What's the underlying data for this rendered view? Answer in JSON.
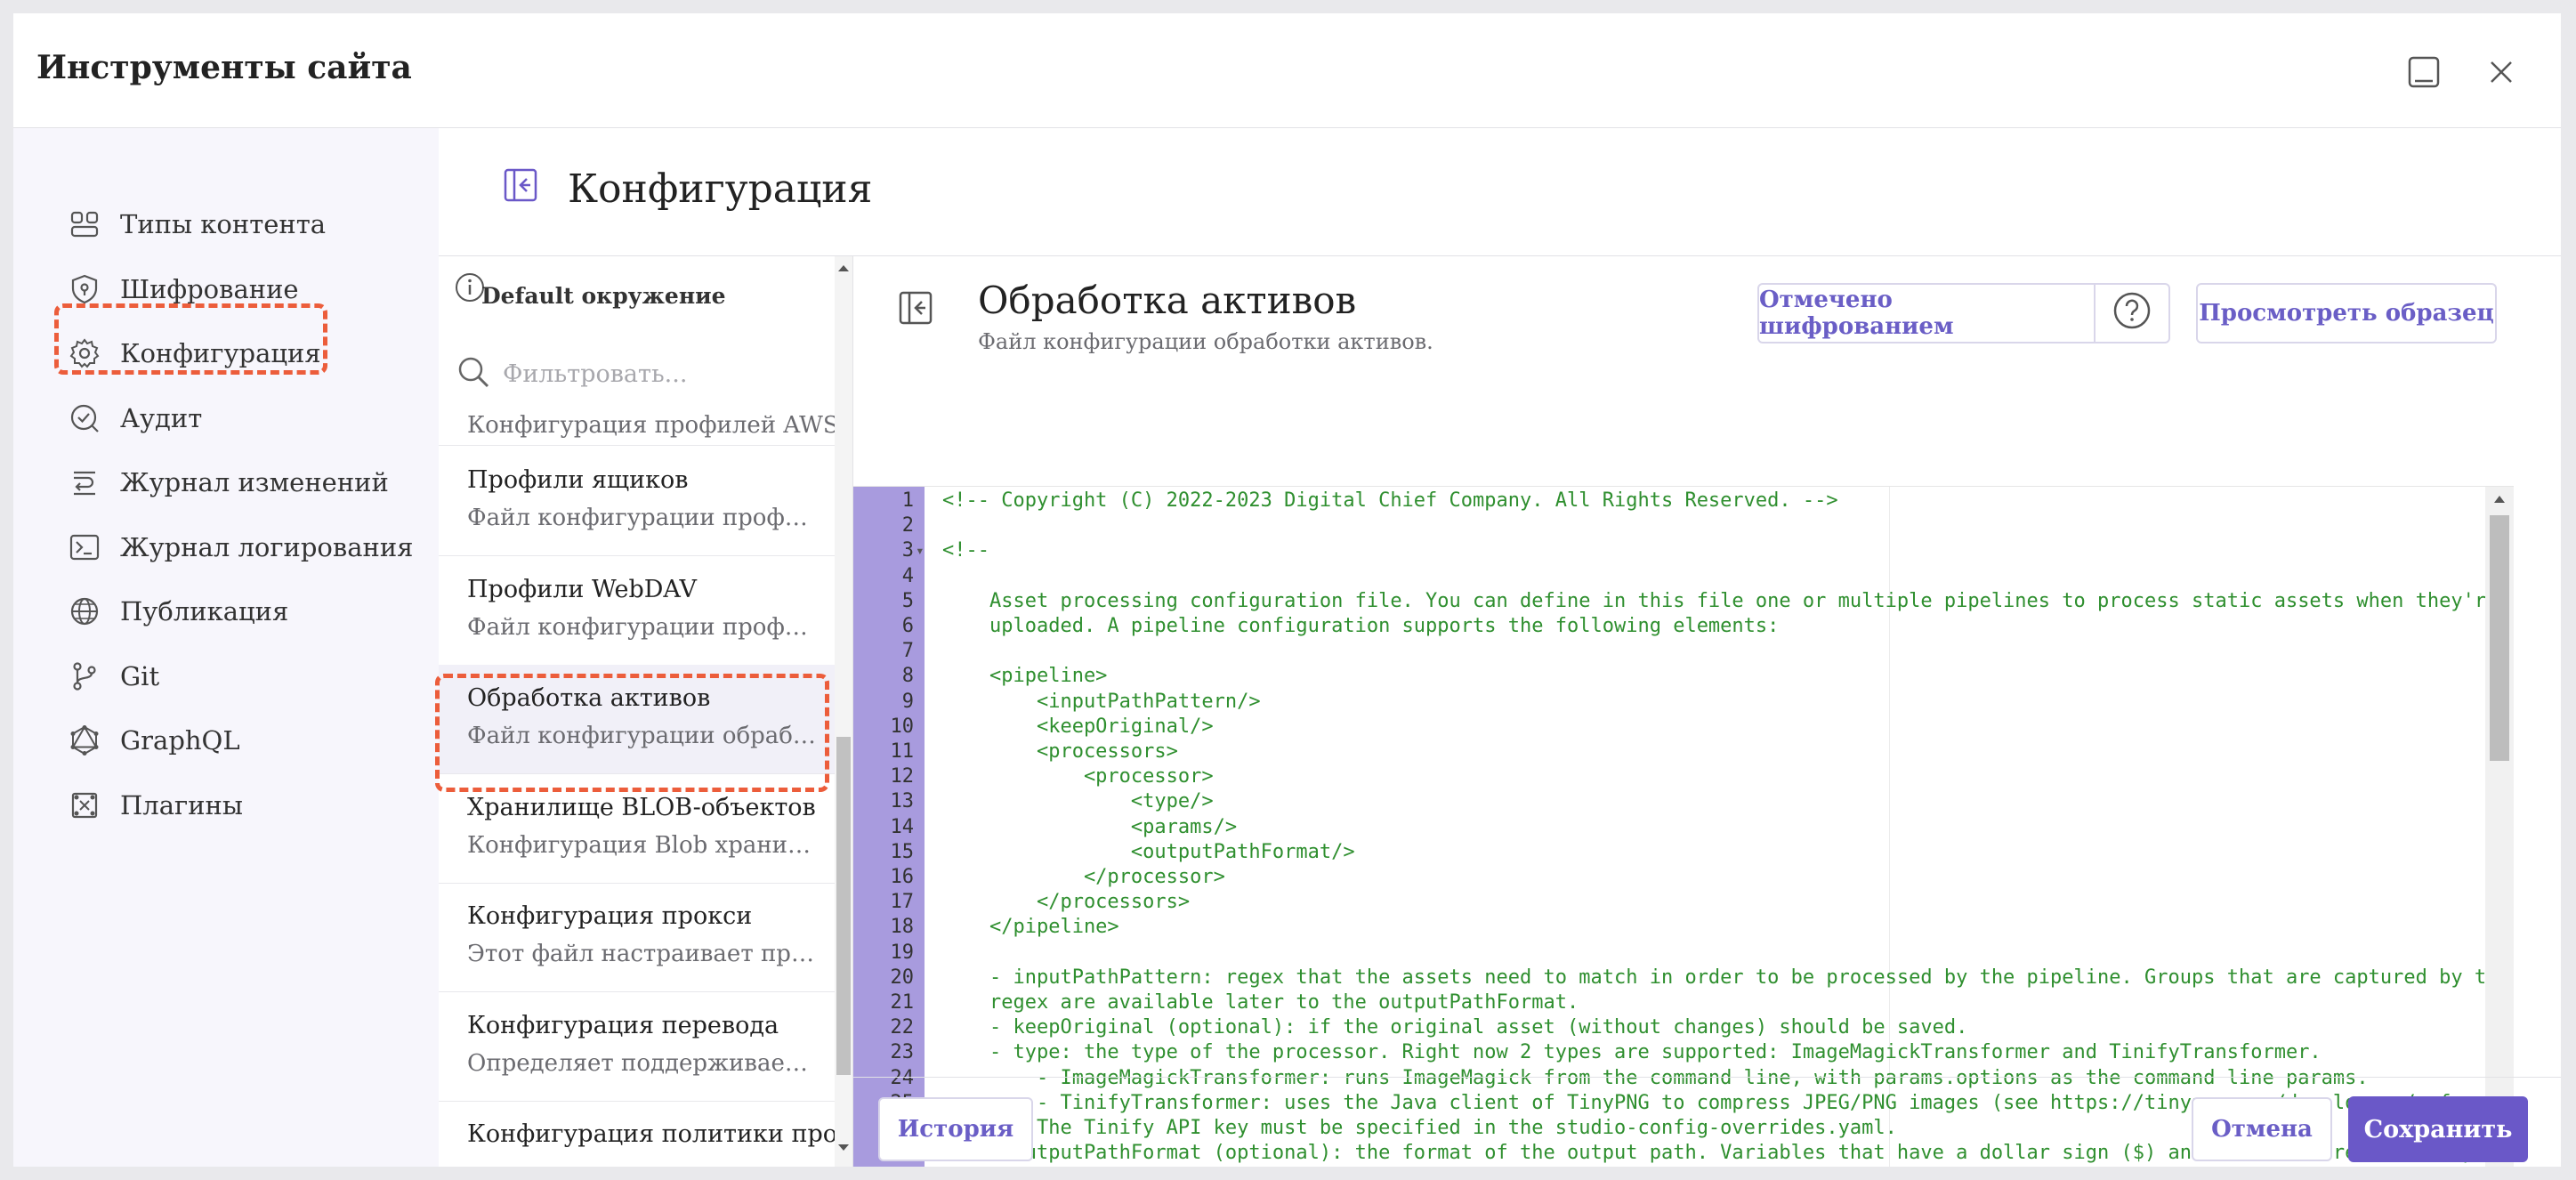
{
  "dialog": {
    "title": "Инструменты сайта"
  },
  "sidebar": {
    "items": [
      {
        "label": "Типы контента",
        "icon": "content-types-icon"
      },
      {
        "label": "Шифрование",
        "icon": "encryption-shield-icon"
      },
      {
        "label": "Конфигурация",
        "icon": "gear-icon"
      },
      {
        "label": "Аудит",
        "icon": "audit-check-icon"
      },
      {
        "label": "Журнал изменений",
        "icon": "change-log-icon"
      },
      {
        "label": "Журнал логирования",
        "icon": "terminal-icon"
      },
      {
        "label": "Публикация",
        "icon": "globe-icon"
      },
      {
        "label": "Git",
        "icon": "git-branch-icon"
      },
      {
        "label": "GraphQL",
        "icon": "graphql-icon"
      },
      {
        "label": "Плагины",
        "icon": "plugin-icon"
      }
    ],
    "highlighted": "Конфигурация"
  },
  "main": {
    "title": "Конфигурация"
  },
  "list": {
    "environment_label": "Default окружение",
    "filter_placeholder": "Фильтровать...",
    "partial_top_item": "Конфигурация профилей AWS.",
    "items": [
      {
        "title": "Профили ящиков",
        "desc": "Файл конфигурации профилей ящиков"
      },
      {
        "title": "Профили WebDAV",
        "desc": "Файл конфигурации профилей WebDAV"
      },
      {
        "title": "Обработка активов",
        "desc": "Файл конфигурации обработки активов."
      },
      {
        "title": "Хранилище BLOB-объектов",
        "desc": "Конфигурация Blob хранилища"
      },
      {
        "title": "Конфигурация прокси",
        "desc": "Этот файл настраивает прокси"
      },
      {
        "title": "Конфигурация перевода",
        "desc": "Определяет поддерживаемые языки"
      },
      {
        "title": "Конфигурация политики про...",
        "desc": ""
      }
    ],
    "selected": "Обработка активов"
  },
  "panel": {
    "title": "Обработка активов",
    "subtitle": "Файл конфигурации обработки активов.",
    "encrypted_button": "Отмечено шифрованием",
    "view_sample_button": "Просмотреть образец"
  },
  "editor": {
    "lines": [
      "<!-- Copyright (C) 2022-2023 Digital Chief Company. All Rights Reserved. -->",
      "",
      "<!--",
      "",
      "    Asset processing configuration file. You can define in this file one or multiple pipelines to process static assets when they're",
      "    uploaded. A pipeline configuration supports the following elements:",
      "",
      "    <pipeline>",
      "        <inputPathPattern/>",
      "        <keepOriginal/>",
      "        <processors>",
      "            <processor>",
      "                <type/>",
      "                <params/>",
      "                <outputPathFormat/>",
      "            </processor>",
      "        </processors>",
      "    </pipeline>",
      "",
      "    - inputPathPattern: regex that the assets need to match in order to be processed by the pipeline. Groups that are captured by thi",
      "    regex are available later to the outputPathFormat.",
      "    - keepOriginal (optional): if the original asset (without changes) should be saved.",
      "    - type: the type of the processor. Right now 2 types are supported: ImageMagickTransformer and TinifyTransformer.",
      "        - ImageMagickTransformer: runs ImageMagick from the command line, with params.options as the command line params.",
      "        - TinifyTransformer: uses the Java client of TinyPNG to compress JPEG/PNG images (see https://tinypng.com/developers/referenc",
      "        The Tinify API key must be specified in the studio-config-overrides.yaml.",
      "    - outputPathFormat (optional): the format of the output path. Variables that have a dollar sign ($) and an index are later replac",
      ""
    ],
    "fold_lines": [
      3
    ],
    "gutter_color": "#a89bde",
    "code_color": "#2f8f2f"
  },
  "footer": {
    "history_button": "История",
    "cancel_button": "Отмена",
    "save_button": "Сохранить"
  },
  "colors": {
    "accent": "#6a58c8",
    "highlight": "#ec5d3b"
  }
}
